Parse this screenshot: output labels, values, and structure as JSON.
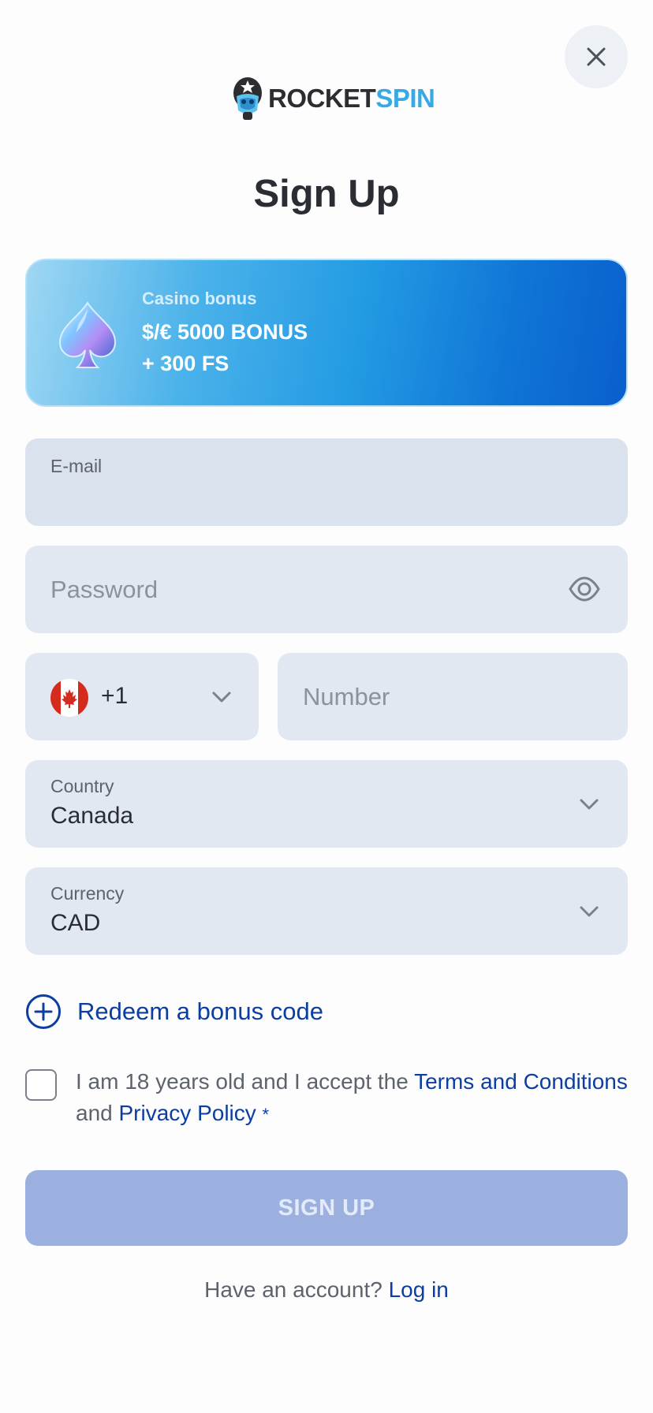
{
  "logo": {
    "word_a": "ROCKET",
    "word_b": "SPIN"
  },
  "page_title": "Sign Up",
  "bonus": {
    "kicker": "Casino bonus",
    "line1": "$/€ 5000 BONUS",
    "line2": "+ 300 FS"
  },
  "form": {
    "email_label": "E-mail",
    "email_value": "",
    "password_placeholder": "Password",
    "phone_code": "+1",
    "number_placeholder": "Number",
    "country_label": "Country",
    "country_value": "Canada",
    "currency_label": "Currency",
    "currency_value": "CAD"
  },
  "redeem_label": "Redeem a bonus code",
  "consent": {
    "prefix": "I am 18 years old and I accept the ",
    "terms": "Terms and Conditions",
    "and": " and ",
    "privacy": "Privacy Policy",
    "star": "*",
    "checked": false
  },
  "signup_label": "SIGN UP",
  "footer": {
    "question": "Have an account? ",
    "login": "Log in"
  },
  "colors": {
    "accent_blue": "#0c3ea1",
    "brand_light_blue": "#38a9e5",
    "field_bg": "#e2e8f2",
    "button_disabled": "#9cb0e0"
  },
  "icons": {
    "close": "close-icon",
    "eye": "eye-icon",
    "chevron": "chevron-down-icon",
    "flag": "canada-flag-icon",
    "plus": "plus-circle-icon",
    "spade": "spade-icon",
    "mascot": "astronaut-logo-icon"
  }
}
